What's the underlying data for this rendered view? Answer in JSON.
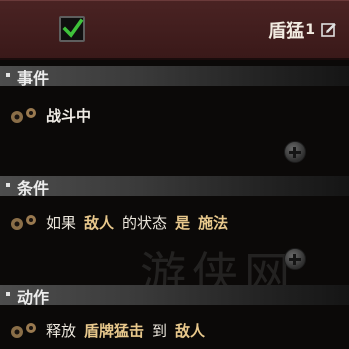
{
  "header": {
    "title": "盾猛",
    "title_number": "1",
    "checkbox_checked": true
  },
  "sections": {
    "events": {
      "label": "事件"
    },
    "conditions": {
      "label": "条件"
    },
    "actions": {
      "label": "动作"
    }
  },
  "events_row": {
    "text": "战斗中"
  },
  "conditions_row": {
    "words": [
      "如果",
      "敌人",
      "的状态",
      "是",
      "施法"
    ]
  },
  "actions_row": {
    "words": [
      "释放",
      "盾牌猛击",
      "到",
      "敌人"
    ]
  },
  "watermark": "游侠网",
  "colors": {
    "header_bg": "#3f1c1c",
    "keyword_gold": "#e8c88c",
    "check_green": "#3fc23b"
  }
}
